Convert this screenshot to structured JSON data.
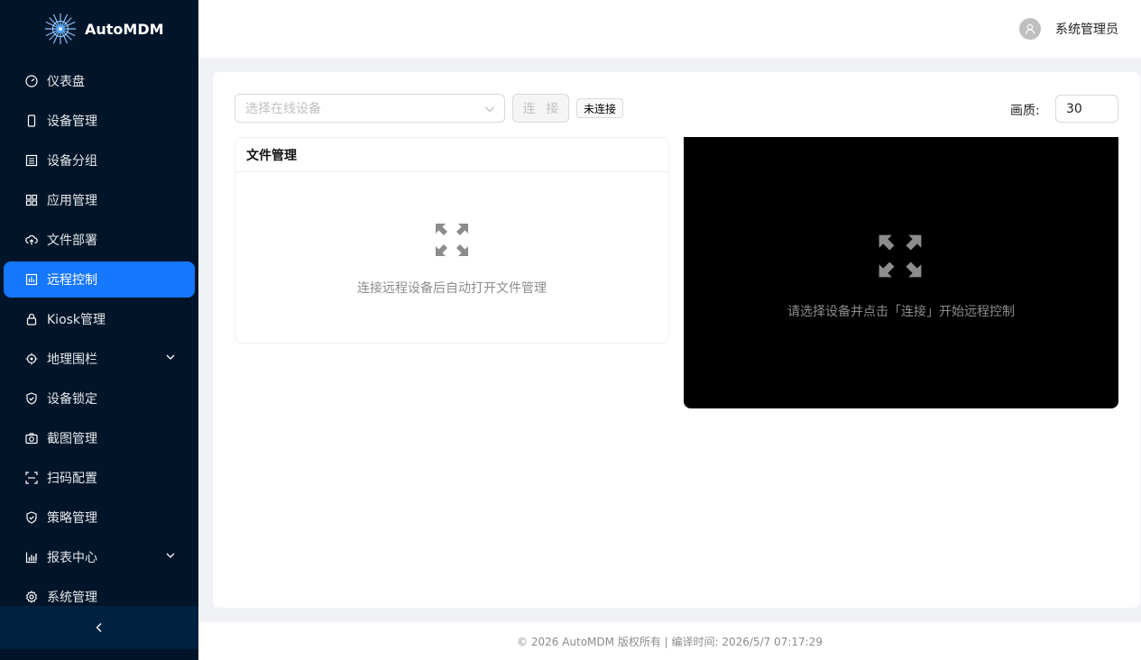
{
  "brand": {
    "name": "AutoMDM"
  },
  "sidebar": {
    "items": [
      {
        "label": "仪表盘",
        "icon": "dashboard-icon"
      },
      {
        "label": "设备管理",
        "icon": "mobile-icon"
      },
      {
        "label": "设备分组",
        "icon": "group-icon"
      },
      {
        "label": "应用管理",
        "icon": "apps-icon"
      },
      {
        "label": "文件部署",
        "icon": "cloud-upload-icon"
      },
      {
        "label": "远程控制",
        "icon": "remote-control-icon",
        "active": true
      },
      {
        "label": "Kiosk管理",
        "icon": "lock-icon"
      },
      {
        "label": "地理围栏",
        "icon": "location-icon",
        "expandable": true
      },
      {
        "label": "设备锁定",
        "icon": "shield-icon"
      },
      {
        "label": "截图管理",
        "icon": "camera-icon"
      },
      {
        "label": "扫码配置",
        "icon": "scan-icon"
      },
      {
        "label": "策略管理",
        "icon": "policy-icon"
      },
      {
        "label": "报表中心",
        "icon": "bar-chart-icon",
        "expandable": true
      },
      {
        "label": "系统管理",
        "icon": "settings-icon"
      }
    ]
  },
  "header": {
    "user_name": "系统管理员"
  },
  "toolbar": {
    "device_placeholder": "选择在线设备",
    "connect_label": "连 接",
    "status": "未连接",
    "quality_label": "画质:",
    "quality_value": "30"
  },
  "file_manager": {
    "title": "文件管理",
    "empty_text": "连接远程设备后自动打开文件管理"
  },
  "remote_screen": {
    "empty_text": "请选择设备并点击「连接」开始远程控制"
  },
  "footer": {
    "text": "© 2026 AutoMDM 版权所有 | 编译时间: 2026/5/7 07:17:29"
  },
  "colors": {
    "sidebar_bg": "#001529",
    "active": "#1677ff",
    "screen_bg": "#000000"
  }
}
